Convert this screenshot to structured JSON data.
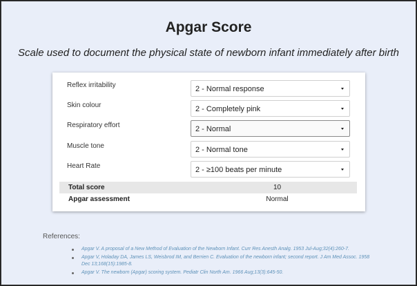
{
  "title": "Apgar Score",
  "subtitle": "Scale used to document the physical state of newborn infant immediately after birth",
  "form": {
    "rows": [
      {
        "label": "Reflex irritability",
        "value": "2 - Normal response"
      },
      {
        "label": "Skin colour",
        "value": "2 - Completely pink"
      },
      {
        "label": "Respiratory effort",
        "value": "2 - Normal"
      },
      {
        "label": "Muscle tone",
        "value": "2 - Normal tone"
      },
      {
        "label": "Heart Rate",
        "value": "2 - ≥100 beats per minute"
      }
    ],
    "total_label": "Total score",
    "total_value": "10",
    "assessment_label": "Apgar assessment",
    "assessment_value": "Normal"
  },
  "references": {
    "heading": "References:",
    "items": [
      "Apgar V. A proposal of a New Method of Evaluation of the Newborn Infant. Curr Res Anesth Analg. 1953 Jul-Aug;32(4):260-7.",
      "Apgar V, Holaday DA, James LS, Weisbrod IM, and Berrien C. Evaluation of the newborn infant; second report. J Am Med Assoc. 1958 Dec 13;168(15):1985-8.",
      "Apgar V. The newborn (Apgar) scoring system. Pediatr Clin North Am. 1966 Aug;13(3):645-50."
    ]
  },
  "colors": {
    "background": "#e9eef9",
    "link": "#5d91b8",
    "summary_shade": "#e7e7e7"
  }
}
